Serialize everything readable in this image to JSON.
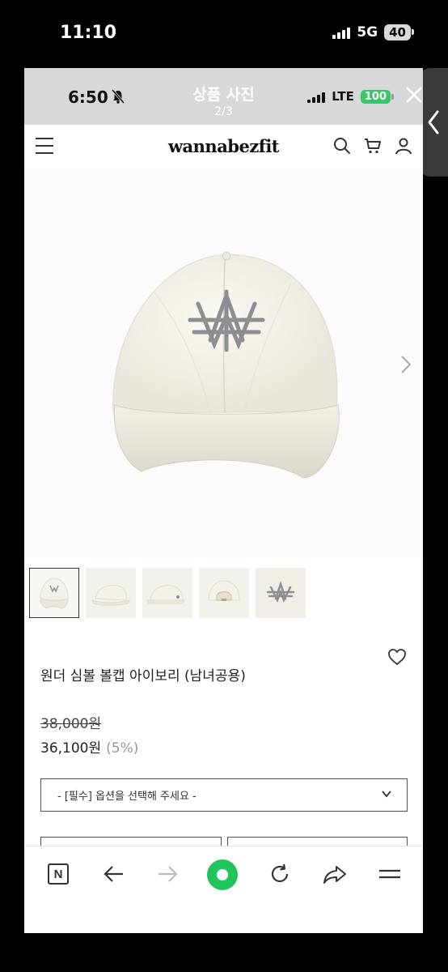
{
  "outer_status": {
    "time": "11:10",
    "network": "5G",
    "battery": "40"
  },
  "inner_status": {
    "time": "6:50",
    "network": "LTE",
    "battery": "100"
  },
  "viewer": {
    "title": "상품 사진",
    "counter": "2/3"
  },
  "shop": {
    "logo": "wannabezfit"
  },
  "product": {
    "name": "원더 심볼 볼캡 아이보리 (남녀공용)",
    "original_price": "38,000원",
    "sale_price": "36,100원",
    "discount": "(5%)",
    "option_placeholder": "- [필수] 옵션을 선택해 주세요 -"
  },
  "thumbnails": [
    {
      "label": "front"
    },
    {
      "label": "side-left"
    },
    {
      "label": "side-right"
    },
    {
      "label": "back"
    },
    {
      "label": "logo-detail"
    }
  ],
  "colors": {
    "accent_green": "#21c45a",
    "battery_green": "#3bc46a"
  },
  "icons": [
    "menu-icon",
    "search-icon",
    "cart-icon",
    "user-icon",
    "heart-icon",
    "back-icon",
    "forward-icon",
    "refresh-icon",
    "share-icon",
    "hamburger-icon",
    "close-icon",
    "bell-off-icon"
  ]
}
